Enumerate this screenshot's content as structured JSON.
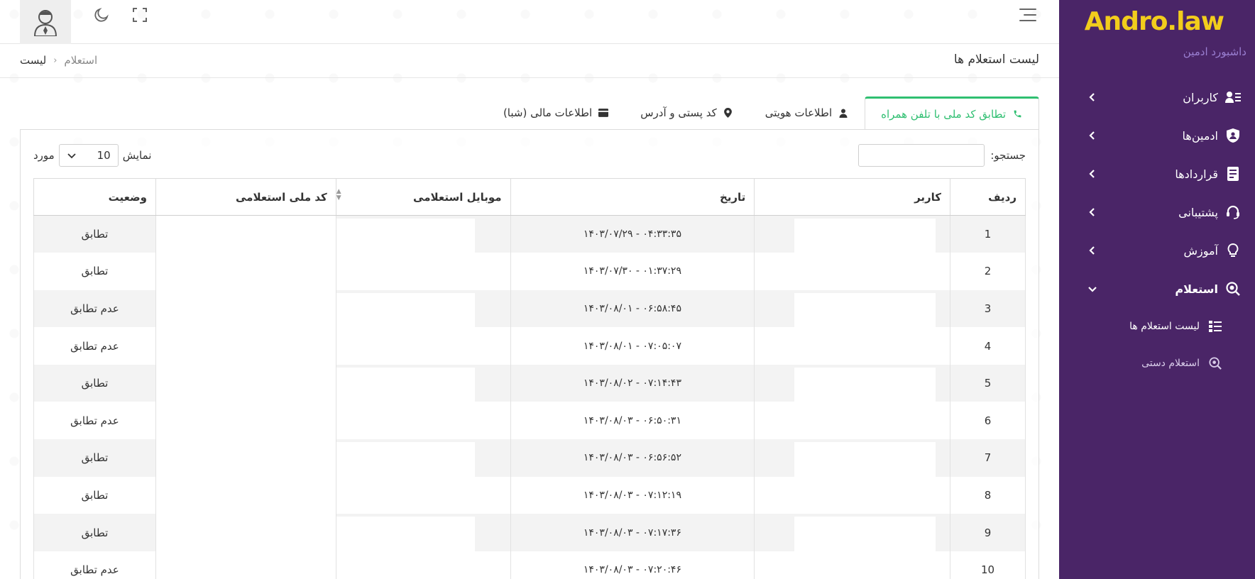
{
  "brand": {
    "name": "Andro.law",
    "subtitle": "داشبورد ادمین"
  },
  "nav": {
    "items": [
      {
        "label": "کاربران",
        "icon": "users-list-icon"
      },
      {
        "label": "ادمین‌ها",
        "icon": "shield-user-icon"
      },
      {
        "label": "قراردادها",
        "icon": "contract-icon"
      },
      {
        "label": "پشتیبانی",
        "icon": "headset-icon"
      },
      {
        "label": "آموزش",
        "icon": "lightbulb-icon"
      },
      {
        "label": "استعلام",
        "icon": "search-inquiry-icon"
      }
    ],
    "sub_items": [
      {
        "label": "لیست استعلام ها",
        "icon": "list-icon"
      },
      {
        "label": "استعلام دستی",
        "icon": "search-icon"
      }
    ]
  },
  "page": {
    "title": "لیست استعلام ها",
    "breadcrumb": {
      "current": "لیست",
      "parent": "استعلام",
      "separator": "‹"
    }
  },
  "tabs": [
    {
      "label": "تطابق کد ملی با تلفن همراه",
      "icon": "phone-icon",
      "active": true
    },
    {
      "label": "اطلاعات هویتی",
      "icon": "person-icon",
      "active": false
    },
    {
      "label": "کد پستی و آدرس",
      "icon": "location-pin-icon",
      "active": false
    },
    {
      "label": "اطلاعات مالی (شبا)",
      "icon": "card-icon",
      "active": false
    }
  ],
  "table_controls": {
    "search_label": "جستجو:",
    "length_prefix": "نمایش",
    "length_value": "10",
    "length_suffix": "مورد"
  },
  "table": {
    "headers": [
      "ردیف",
      "کاربر",
      "تاریخ",
      "موبایل استعلامی",
      "کد ملی استعلامی",
      "وضعیت"
    ],
    "rows": [
      {
        "row": "1",
        "date": "۱۴۰۳/۰۷/۲۹ - ۰۴:۳۳:۳۵",
        "status": "تطابق"
      },
      {
        "row": "2",
        "date": "۱۴۰۳/۰۷/۳۰ - ۰۱:۳۷:۲۹",
        "status": "تطابق"
      },
      {
        "row": "3",
        "date": "۱۴۰۳/۰۸/۰۱ - ۰۶:۵۸:۴۵",
        "status": "عدم تطابق"
      },
      {
        "row": "4",
        "date": "۱۴۰۳/۰۸/۰۱ - ۰۷:۰۵:۰۷",
        "status": "عدم تطابق"
      },
      {
        "row": "5",
        "date": "۱۴۰۳/۰۸/۰۲ - ۰۷:۱۴:۴۳",
        "status": "تطابق"
      },
      {
        "row": "6",
        "date": "۱۴۰۳/۰۸/۰۳ - ۰۶:۵۰:۳۱",
        "status": "عدم تطابق"
      },
      {
        "row": "7",
        "date": "۱۴۰۳/۰۸/۰۳ - ۰۶:۵۶:۵۲",
        "status": "تطابق"
      },
      {
        "row": "8",
        "date": "۱۴۰۳/۰۸/۰۳ - ۰۷:۱۲:۱۹",
        "status": "تطابق"
      },
      {
        "row": "9",
        "date": "۱۴۰۳/۰۸/۰۳ - ۰۷:۱۷:۳۶",
        "status": "تطابق"
      },
      {
        "row": "10",
        "date": "۱۴۰۳/۰۸/۰۳ - ۰۷:۲۰:۴۶",
        "status": "عدم تطابق"
      }
    ]
  },
  "colors": {
    "sidebar_bg": "#4a2567",
    "brand_yellow": "#f2cd1c",
    "active_tab_green": "#2fbf71"
  }
}
